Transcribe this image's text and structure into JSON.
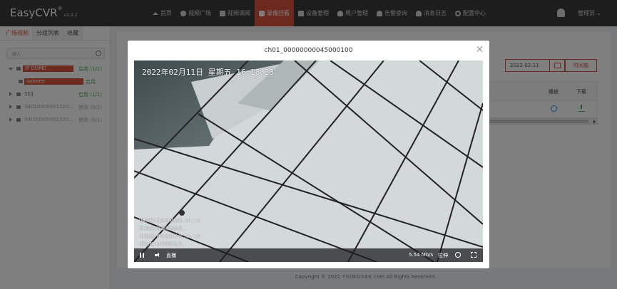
{
  "header": {
    "logo": "EasyCVR",
    "logo_sup": "®",
    "version": "v2.0.2",
    "nav": [
      {
        "label": "首页",
        "icon": "home-icon"
      },
      {
        "label": "视频广场",
        "icon": "play-circle-icon"
      },
      {
        "label": "视频调阅",
        "icon": "video-grid-icon"
      },
      {
        "label": "录像回看",
        "icon": "camera-icon",
        "active": true
      },
      {
        "label": "设备管理",
        "icon": "device-icon"
      },
      {
        "label": "用户管理",
        "icon": "user-icon"
      },
      {
        "label": "告警查询",
        "icon": "alarm-icon"
      },
      {
        "label": "消息日志",
        "icon": "bell-icon"
      },
      {
        "label": "配置中心",
        "icon": "gear-icon"
      }
    ],
    "admin_label": "管理员 ⌄"
  },
  "sidebar": {
    "tabs": [
      "广场视频",
      "分组列表",
      "收藏"
    ],
    "search_placeholder": "输入",
    "tree": [
      {
        "name": "IP DOME",
        "status": "启用 (1/1)",
        "expanded": true
      },
      {
        "name": "ipdome",
        "status": "启用",
        "child": true
      },
      {
        "name": "111",
        "status": "启用 (1/1)"
      },
      {
        "name": "34020000001320...",
        "status": "禁用 (0/1)",
        "disabled": true
      },
      {
        "name": "34020000001320...",
        "status": "禁用 (0/1)",
        "disabled": true
      }
    ]
  },
  "main": {
    "date": "2022-02-11",
    "time_axis_button": "时间轴",
    "table_headers": [
      "播放",
      "下载"
    ]
  },
  "footer": {
    "text_pre": "Copyright © 2022 ",
    "brand": "TSINGSEE",
    "text_post": ".com All Rights Reserved."
  },
  "modal": {
    "title": "ch01_00000000045000100",
    "osd": "2022年02月11日 星期五 16:18:23",
    "logs": [
      "[播放器] 播放器初始化...[4.1.0]",
      "[播放器] 加载视频信息...",
      "[播放器] 播放器初始化...[4.1.0]",
      "[播放器] 加载视频信息..."
    ],
    "controls": {
      "live_label": "直播",
      "bitrate": "5.54 Mb/s",
      "ptz_label": "拉伸"
    }
  },
  "colors": {
    "accent": "#d9533c",
    "topbar": "#3a3a3a",
    "enabled": "#4caf50"
  }
}
